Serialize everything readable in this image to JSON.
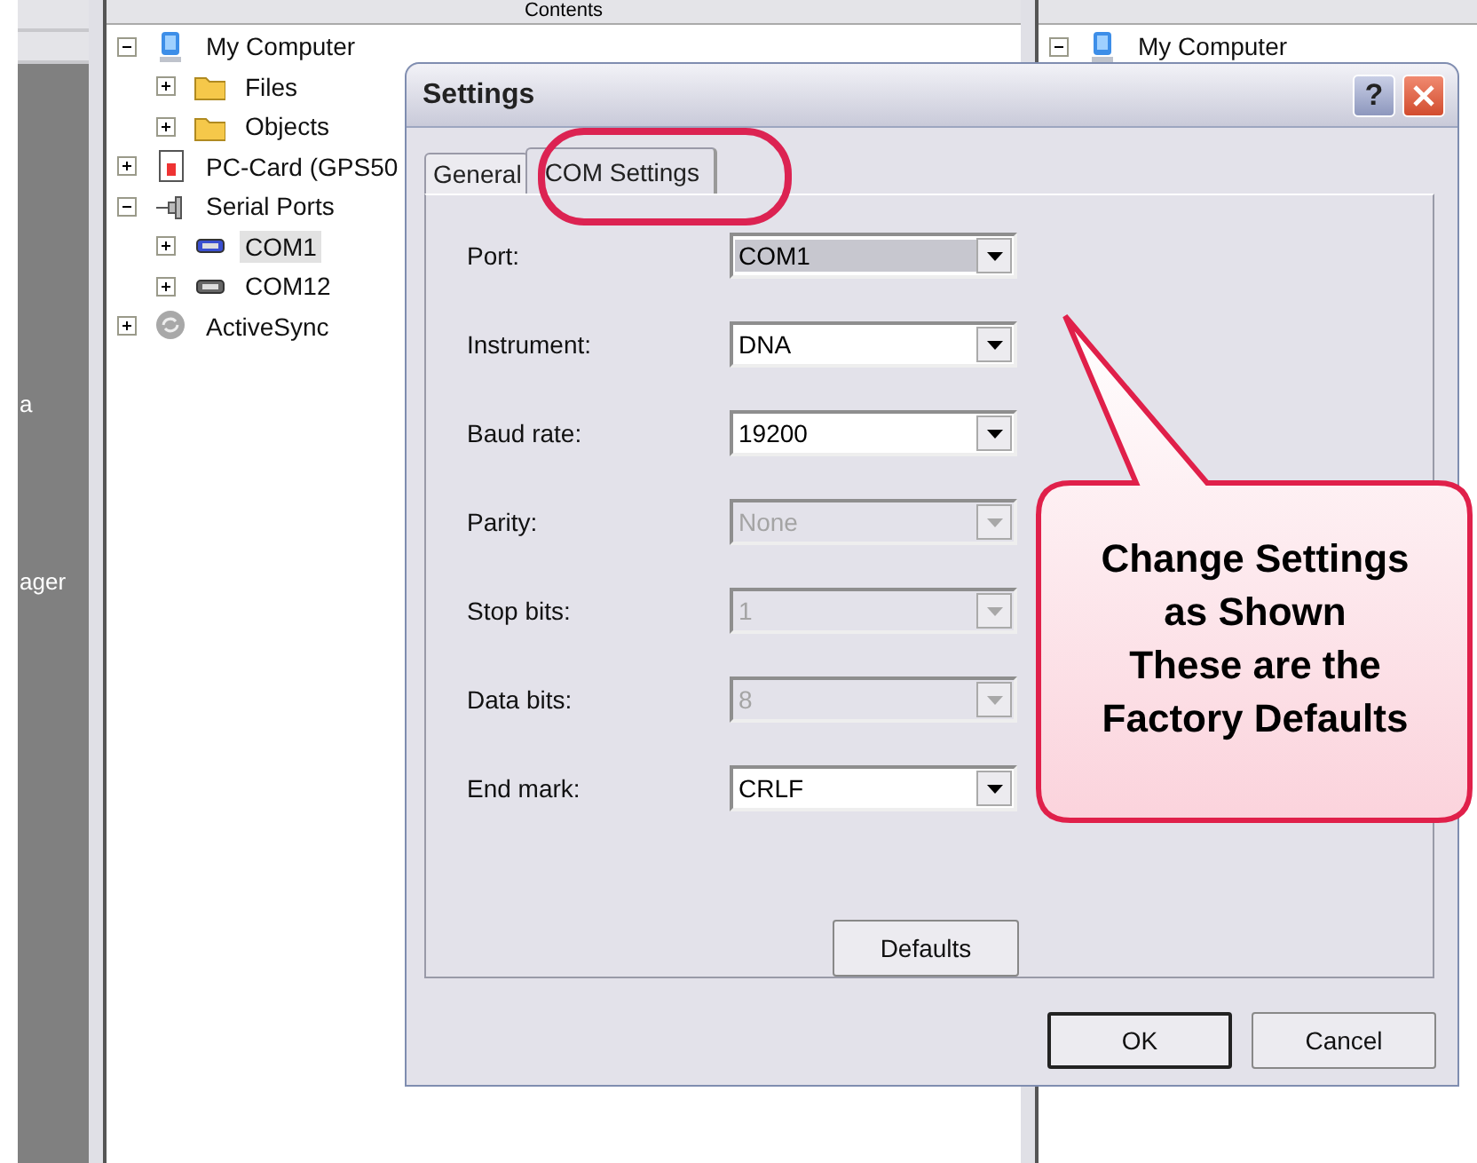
{
  "background": {
    "left_panel": {
      "texts": [
        "a",
        "ager"
      ]
    },
    "contents_pane": {
      "header": "Contents",
      "tree": [
        {
          "label": "My Computer",
          "kind": "computer",
          "expanded": true,
          "selected": false,
          "children": [
            {
              "label": "Files",
              "kind": "folder",
              "expanded": false,
              "selected": false
            },
            {
              "label": "Objects",
              "kind": "folder",
              "expanded": false,
              "selected": false
            }
          ]
        },
        {
          "label": "PC-Card (GPS50",
          "kind": "card",
          "expanded": false,
          "selected": false
        },
        {
          "label": "Serial Ports",
          "kind": "connector",
          "expanded": true,
          "selected": false,
          "children": [
            {
              "label": "COM1",
              "kind": "port",
              "expanded": false,
              "selected": true
            },
            {
              "label": "COM12",
              "kind": "port",
              "expanded": false,
              "selected": false
            }
          ]
        },
        {
          "label": "ActiveSync",
          "kind": "sync",
          "expanded": false,
          "selected": false
        }
      ]
    },
    "right_pane": {
      "tree": [
        {
          "label": "My Computer",
          "kind": "computer",
          "expanded": true,
          "selected": false
        }
      ]
    }
  },
  "dialog": {
    "title": "Settings",
    "help_label": "?",
    "tabs": [
      {
        "label": "General",
        "selected": false
      },
      {
        "label": "COM Settings",
        "selected": true
      }
    ],
    "fields": [
      {
        "label": "Port:",
        "value": "COM1",
        "disabled": false,
        "focused": true
      },
      {
        "label": "Instrument:",
        "value": "DNA",
        "disabled": false,
        "focused": false
      },
      {
        "label": "Baud rate:",
        "value": "19200",
        "disabled": false,
        "focused": false
      },
      {
        "label": "Parity:",
        "value": "None",
        "disabled": true,
        "focused": false
      },
      {
        "label": "Stop bits:",
        "value": "1",
        "disabled": true,
        "focused": false
      },
      {
        "label": "Data bits:",
        "value": "8",
        "disabled": true,
        "focused": false
      },
      {
        "label": "End mark:",
        "value": "CRLF",
        "disabled": false,
        "focused": false
      }
    ],
    "panel_button": "Defaults",
    "buttons": [
      {
        "label": "OK",
        "default": true
      },
      {
        "label": "Cancel",
        "default": false
      }
    ]
  },
  "callout": {
    "text": "Change Settings\nas Shown\nThese are the\nFactory Defaults"
  }
}
